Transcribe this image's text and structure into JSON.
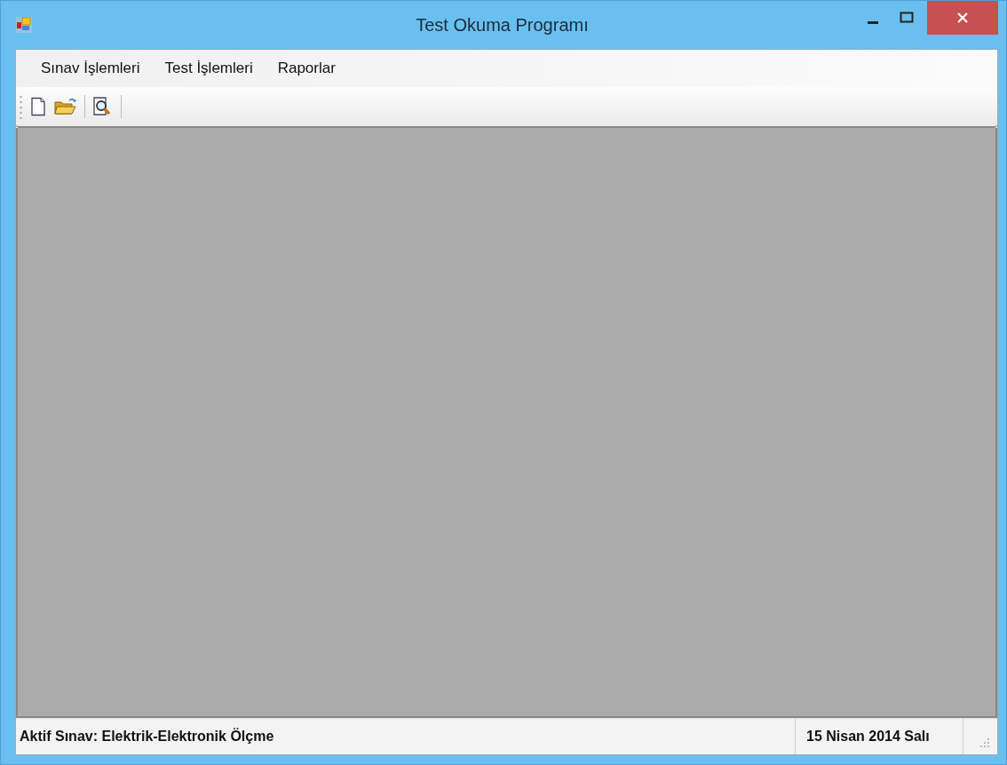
{
  "window": {
    "title": "Test Okuma Programı"
  },
  "menu": [
    {
      "label": "Sınav İşlemleri"
    },
    {
      "label": "Test İşlemleri"
    },
    {
      "label": "Raporlar"
    }
  ],
  "toolbar": [
    {
      "kind": "new"
    },
    {
      "kind": "open"
    },
    {
      "kind": "separator"
    },
    {
      "kind": "preview"
    },
    {
      "kind": "separator"
    }
  ],
  "status_bar": {
    "exam": "Aktif Sınav: Elektrik-Elektronik Ölçme",
    "date": "15 Nisan 2014 Salı"
  }
}
